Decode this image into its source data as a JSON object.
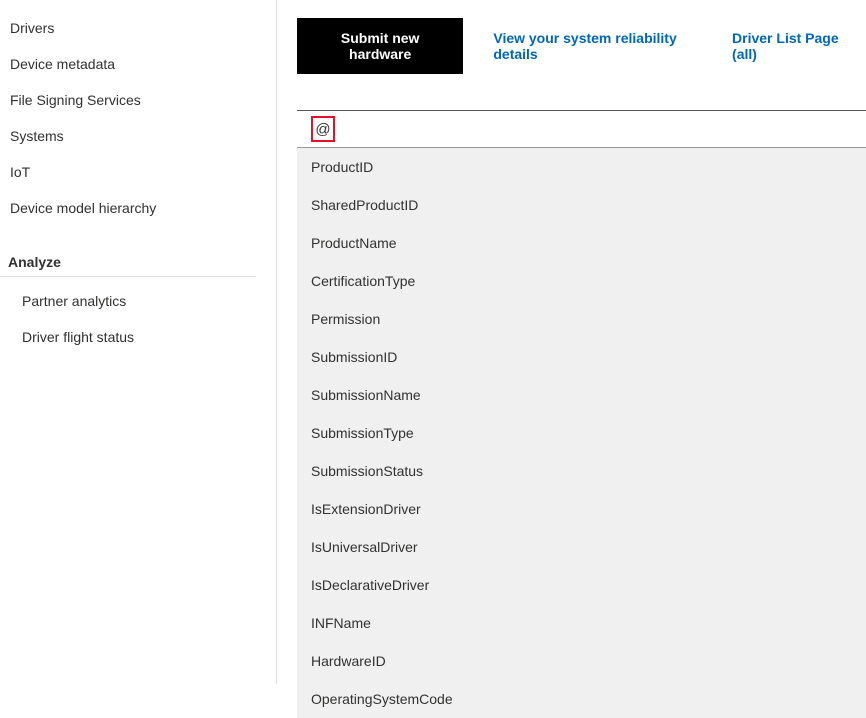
{
  "sidebar": {
    "nav_items": [
      {
        "label": "Drivers"
      },
      {
        "label": "Device metadata"
      },
      {
        "label": "File Signing Services"
      },
      {
        "label": "Systems"
      },
      {
        "label": "IoT"
      },
      {
        "label": "Device model hierarchy"
      }
    ],
    "section_header": "Analyze",
    "sub_items": [
      {
        "label": "Partner analytics"
      },
      {
        "label": "Driver flight status"
      }
    ]
  },
  "top_actions": {
    "submit_btn": "Submit new hardware",
    "reliability_link": "View your system reliability details",
    "driver_list_link": "Driver List Page (all)"
  },
  "search": {
    "at_symbol": "@",
    "value": ""
  },
  "dropdown_items": [
    "ProductID",
    "SharedProductID",
    "ProductName",
    "CertificationType",
    "Permission",
    "SubmissionID",
    "SubmissionName",
    "SubmissionType",
    "SubmissionStatus",
    "IsExtensionDriver",
    "IsUniversalDriver",
    "IsDeclarativeDriver",
    "INFName",
    "HardwareID",
    "OperatingSystemCode"
  ]
}
